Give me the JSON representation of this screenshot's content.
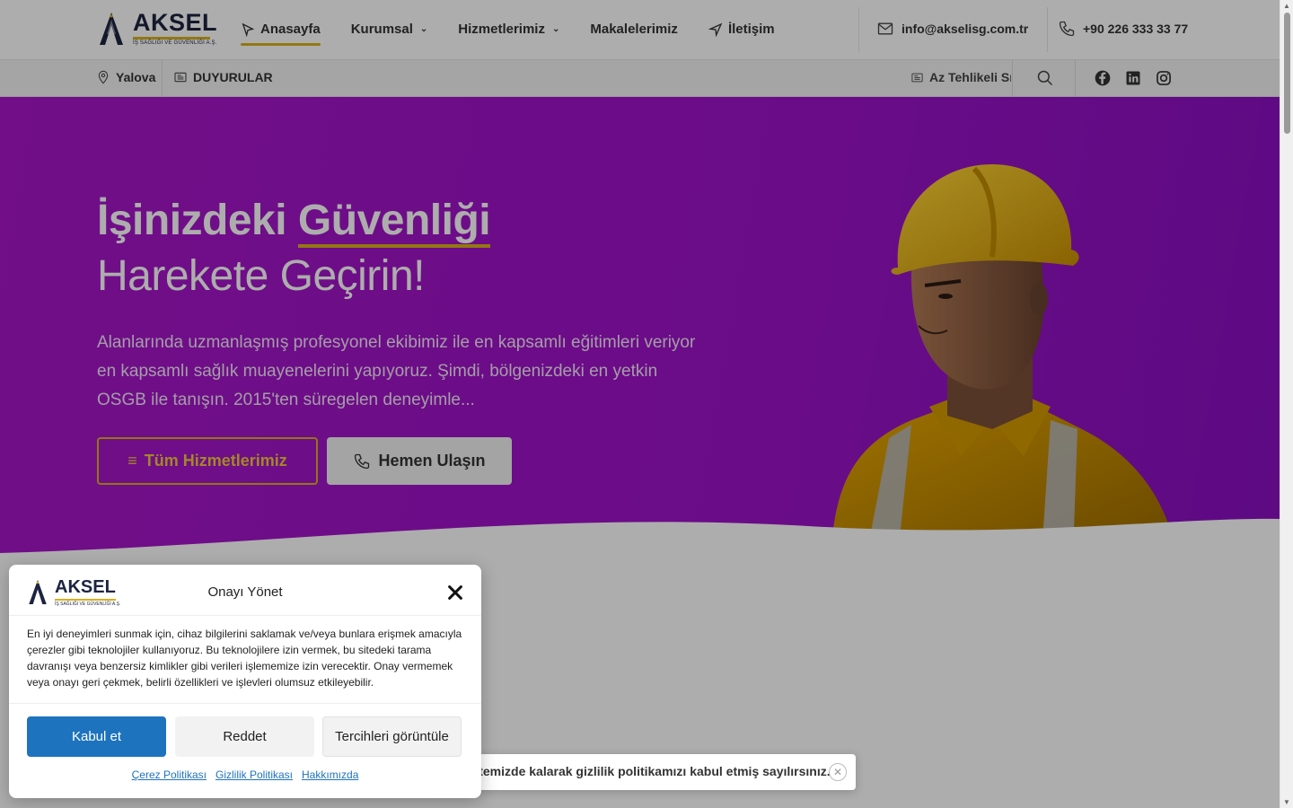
{
  "header": {
    "logo_brand": "AKSEL",
    "logo_sub": "İŞ SAĞLIĞI VE GÜVENLİĞİ A.Ş.",
    "nav": [
      {
        "label": "Anasayfa",
        "active": true,
        "icon": "cursor-arrow-icon"
      },
      {
        "label": "Kurumsal",
        "dropdown": true
      },
      {
        "label": "Hizmetlerimiz",
        "dropdown": true
      },
      {
        "label": "Makalelerimiz"
      },
      {
        "label": "İletişim",
        "icon": "navigation-icon"
      }
    ],
    "email": "info@akselisg.com.tr",
    "phone": "+90 226 333 33 77"
  },
  "subbar": {
    "location": "Yalova",
    "announcements": "DUYURULAR",
    "ticker": "Az Tehlikeli Sı"
  },
  "hero": {
    "title_part1": "İşinizdeki",
    "title_highlight": "Güvenliği",
    "title_line2": "Harekete Geçirin!",
    "description": "Alanlarında uzmanlaşmış profesyonel ekibimiz ile en kapsamlı eğitimleri veriyor en kapsamlı sağlık muayenelerini yapıyoruz. Şimdi, bölgenizdeki en yetkin OSGB ile tanışın. 2015'ten süregelen deneyimle...",
    "btn_services": "Tüm Hizmetlerimiz",
    "btn_contact": "Hemen Ulaşın"
  },
  "consent": {
    "title": "Onayı Yönet",
    "body": "En iyi deneyimleri sunmak için, cihaz bilgilerini saklamak ve/veya bunlara erişmek amacıyla çerezler gibi teknolojiler kullanıyoruz. Bu teknolojilere izin vermek, bu sitedeki tarama davranışı veya benzersiz kimlikler gibi verileri işlememize izin verecektir. Onay vermemek veya onayı geri çekmek, belirli özellikleri ve işlevleri olumsuz etkileyebilir.",
    "accept": "Kabul et",
    "deny": "Reddet",
    "preferences": "Tercihleri görüntüle",
    "links": [
      "Çerez Politikası",
      "Gizlilik Politikası",
      "Hakkımızda"
    ]
  },
  "toast": {
    "text": "Sitemizde kalarak gizlilik politikamızı kabul etmiş sayılırsınız."
  },
  "colors": {
    "accent_yellow": "#d9b11b",
    "hero_purple": "#a216c9",
    "consent_blue": "#1e73be"
  }
}
